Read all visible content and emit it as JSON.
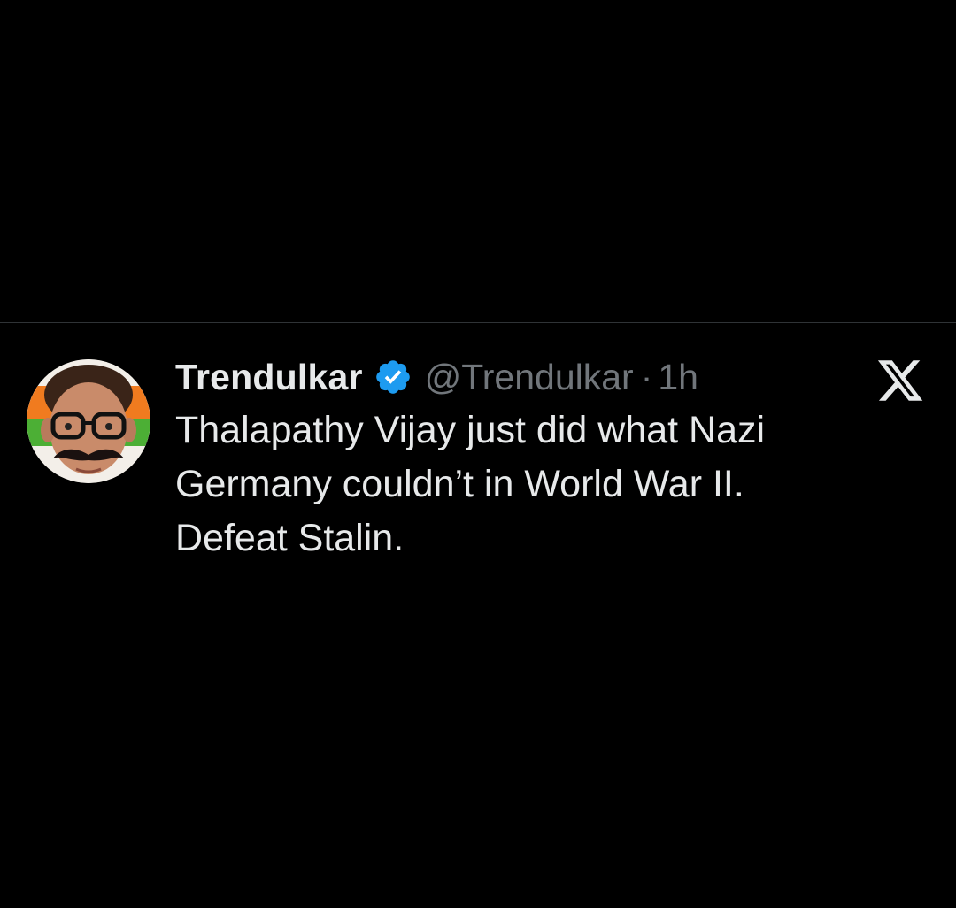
{
  "tweet": {
    "display_name": "Trendulkar",
    "handle": "@Trendulkar",
    "separator": "·",
    "time": "1h",
    "text_lines": [
      "Thalapathy Vijay just did what Nazi",
      "Germany couldn’t in World War II.",
      "Defeat Stalin."
    ],
    "verified": true,
    "avatar_icon": "caricature-avatar-with-glasses-and-mustache",
    "logo_icon": "x-logo-icon"
  },
  "colors": {
    "background": "#000000",
    "primary_text": "#e7e9ea",
    "secondary_text": "#71767b",
    "verified_badge": "#1d9bf0",
    "divider": "#2f3336"
  }
}
